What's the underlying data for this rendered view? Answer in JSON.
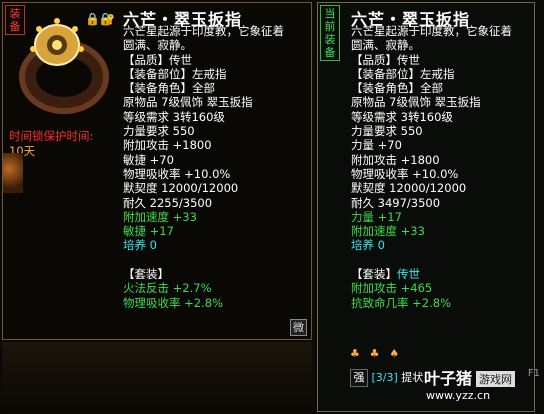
{
  "left": {
    "tag": "装备",
    "title": "六芒・翠玉扳指",
    "desc_line1": "六芒星起源于印度教，它象征着",
    "desc_line2": "圆满、寂静。",
    "quality": "【品质】传世",
    "slot": "【装备部位】左戒指",
    "role": "【装备角色】全部",
    "source": "原物品 7级佩饰 翠玉扳指",
    "level_req": "等级需求 3转160级",
    "str_req": "力量要求 550",
    "add_atk": "附加攻击 +1800",
    "agi": "敏捷 +70",
    "phys_absorb": "物理吸收率 +10.0%",
    "tacit": "默契度 12000/12000",
    "durability": "耐久 2255/3500",
    "add_speed": "附加速度 +33",
    "agi2": "敏捷 +17",
    "cultivate": "培养 0",
    "set_label": "【套装】",
    "set_fire": "火法反击 +2.7%",
    "set_phys": "物理吸收率 +2.8%",
    "protect_label": "时间锁保护时间:",
    "protect_value": "10天",
    "wei_badge": "微"
  },
  "right": {
    "tag": "当前装备",
    "title": "六芒・翠玉扳指",
    "desc_line1": "六芒星起源于印度教，它象征着",
    "desc_line2": "圆满、寂静。",
    "quality": "【品质】传世",
    "slot": "【装备部位】左戒指",
    "role": "【装备角色】全部",
    "source": "原物品 7级佩饰 翠玉扳指",
    "level_req": "等级需求 3转160级",
    "str_req": "力量要求 550",
    "str": "力量 +70",
    "add_atk": "附加攻击 +1800",
    "phys_absorb": "物理吸收率 +10.0%",
    "tacit": "默契度 12000/12000",
    "durability": "耐久 3497/3500",
    "str2": "力量 +17",
    "add_speed": "附加速度 +33",
    "cultivate": "培养 0",
    "set_label": "【套装】",
    "set_name": "传世",
    "set_atk": "附加攻击 +465",
    "set_resist": "抗致命几率 +2.8%",
    "set_count": "[3/3]",
    "set_hint": "提状"
  },
  "watermark": {
    "logo": "叶子猪",
    "box": "游戏网",
    "url": "www.yzz.cn"
  },
  "corner_label": "F1",
  "colors": {
    "title": "#ffffff",
    "green": "#3ddc4a",
    "cyan": "#35e6f0",
    "red": "#ff2b2b"
  }
}
